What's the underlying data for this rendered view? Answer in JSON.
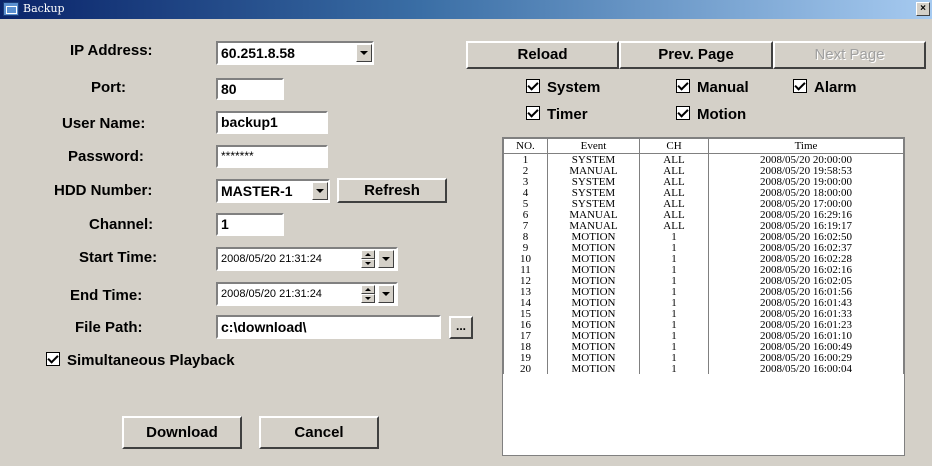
{
  "window": {
    "title": "Backup",
    "close_label": "×"
  },
  "form": {
    "ip_label": "IP Address:",
    "ip_value": "60.251.8.58",
    "port_label": "Port:",
    "port_value": "80",
    "user_label": "User Name:",
    "user_value": "backup1",
    "password_label": "Password:",
    "password_value": "*******",
    "hdd_label": "HDD Number:",
    "hdd_value": "MASTER-1",
    "refresh_label": "Refresh",
    "channel_label": "Channel:",
    "channel_value": "1",
    "start_label": "Start Time:",
    "start_value": "2008/05/20 21:31:24",
    "end_label": "End Time:",
    "end_value": "2008/05/20 21:31:24",
    "path_label": "File Path:",
    "path_value": "c:\\download\\",
    "browse_label": "...",
    "simultaneous_label": "Simultaneous Playback",
    "download_label": "Download",
    "cancel_label": "Cancel"
  },
  "nav": {
    "reload": "Reload",
    "prev": "Prev. Page",
    "next": "Next Page"
  },
  "filters": {
    "system": "System",
    "manual": "Manual",
    "alarm": "Alarm",
    "timer": "Timer",
    "motion": "Motion"
  },
  "table": {
    "headers": [
      "NO.",
      "Event",
      "CH",
      "Time"
    ],
    "rows": [
      [
        "1",
        "SYSTEM",
        "ALL",
        "2008/05/20 20:00:00"
      ],
      [
        "2",
        "MANUAL",
        "ALL",
        "2008/05/20 19:58:53"
      ],
      [
        "3",
        "SYSTEM",
        "ALL",
        "2008/05/20 19:00:00"
      ],
      [
        "4",
        "SYSTEM",
        "ALL",
        "2008/05/20 18:00:00"
      ],
      [
        "5",
        "SYSTEM",
        "ALL",
        "2008/05/20 17:00:00"
      ],
      [
        "6",
        "MANUAL",
        "ALL",
        "2008/05/20 16:29:16"
      ],
      [
        "7",
        "MANUAL",
        "ALL",
        "2008/05/20 16:19:17"
      ],
      [
        "8",
        "MOTION",
        "1",
        "2008/05/20 16:02:50"
      ],
      [
        "9",
        "MOTION",
        "1",
        "2008/05/20 16:02:37"
      ],
      [
        "10",
        "MOTION",
        "1",
        "2008/05/20 16:02:28"
      ],
      [
        "11",
        "MOTION",
        "1",
        "2008/05/20 16:02:16"
      ],
      [
        "12",
        "MOTION",
        "1",
        "2008/05/20 16:02:05"
      ],
      [
        "13",
        "MOTION",
        "1",
        "2008/05/20 16:01:56"
      ],
      [
        "14",
        "MOTION",
        "1",
        "2008/05/20 16:01:43"
      ],
      [
        "15",
        "MOTION",
        "1",
        "2008/05/20 16:01:33"
      ],
      [
        "16",
        "MOTION",
        "1",
        "2008/05/20 16:01:23"
      ],
      [
        "17",
        "MOTION",
        "1",
        "2008/05/20 16:01:10"
      ],
      [
        "18",
        "MOTION",
        "1",
        "2008/05/20 16:00:49"
      ],
      [
        "19",
        "MOTION",
        "1",
        "2008/05/20 16:00:29"
      ],
      [
        "20",
        "MOTION",
        "1",
        "2008/05/20 16:00:04"
      ]
    ]
  }
}
